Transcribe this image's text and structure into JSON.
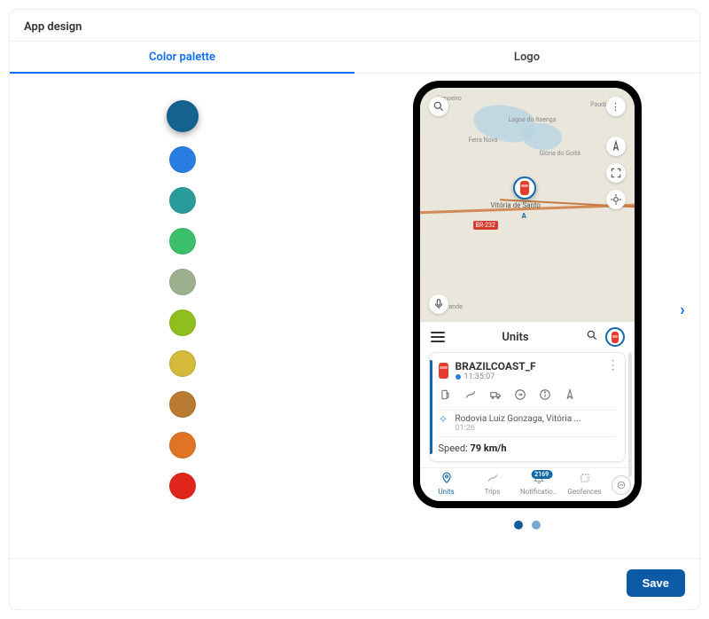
{
  "panel": {
    "title": "App design"
  },
  "tabs": [
    {
      "label": "Color palette",
      "active": true
    },
    {
      "label": "Logo",
      "active": false
    }
  ],
  "palette": {
    "colors": [
      {
        "hex": "#14628f",
        "selected": true
      },
      {
        "hex": "#2a7de1"
      },
      {
        "hex": "#2a9b9b"
      },
      {
        "hex": "#3bbf6b"
      },
      {
        "hex": "#9eb18e"
      },
      {
        "hex": "#8fbe1f"
      },
      {
        "hex": "#d5b93a"
      },
      {
        "hex": "#b97a32"
      },
      {
        "hex": "#e07324"
      },
      {
        "hex": "#e0261c"
      }
    ]
  },
  "preview": {
    "map": {
      "road_badge": "BR-232",
      "places": {
        "limoeiro": "Limoeiro",
        "paudalho": "Paudalho",
        "lagoa": "Lagoa do Itaenga",
        "feira": "Feira Nova",
        "gloria": "Glória do Goitá",
        "vitoria": "Vitória de Santo",
        "cha": "Chã Grande",
        "a_label": "A"
      }
    },
    "sheet": {
      "title": "Units",
      "unit": {
        "name": "BRAZILCOAST_F",
        "time": "11:35:07",
        "address": "Rodovia Luiz Gonzaga, Vitória ...",
        "address_time": "01:26",
        "speed_label": "Speed:",
        "speed_value": "79 km/h"
      }
    },
    "bottom_nav": {
      "units": "Units",
      "trips": "Trips",
      "notifications": "Notificatio..",
      "notifications_count": "2169",
      "geofences": "Geofences"
    }
  },
  "footer": {
    "save": "Save"
  }
}
